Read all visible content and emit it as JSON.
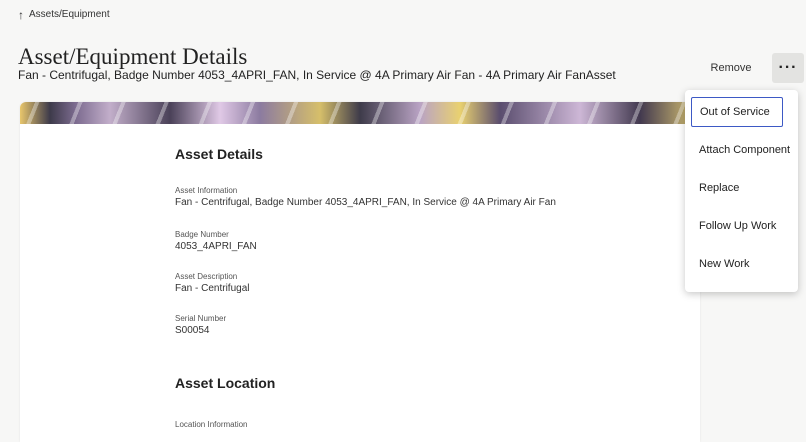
{
  "breadcrumb": {
    "icon": "arrow-up-icon",
    "label": "Assets/Equipment"
  },
  "header": {
    "title": "Asset/Equipment Details",
    "subtitle": "Fan - Centrifugal, Badge Number 4053_4APRI_FAN, In Service @ 4A Primary Air Fan - 4A Primary Air FanAsset"
  },
  "actions": {
    "remove_label": "Remove",
    "more_label": "···",
    "more_icon": "more-horizontal-icon"
  },
  "menu": {
    "items": [
      {
        "label": "Out of Service",
        "focused": true
      },
      {
        "label": "Attach Component"
      },
      {
        "label": "Replace"
      },
      {
        "label": "Follow Up Work"
      },
      {
        "label": "New Work"
      }
    ],
    "focus_color": "#3d59c5"
  },
  "asset_details": {
    "heading": "Asset Details",
    "fields": [
      {
        "label": "Asset Information",
        "value": "Fan - Centrifugal, Badge Number 4053_4APRI_FAN, In Service @ 4A Primary Air Fan"
      },
      {
        "label": "Badge Number",
        "value": "4053_4APRI_FAN"
      },
      {
        "label": "Asset Description",
        "value": "Fan - Centrifugal"
      },
      {
        "label": "Serial Number",
        "value": "S00054"
      }
    ]
  },
  "asset_location": {
    "heading": "Asset Location",
    "fields": [
      {
        "label": "Location Information"
      }
    ]
  }
}
